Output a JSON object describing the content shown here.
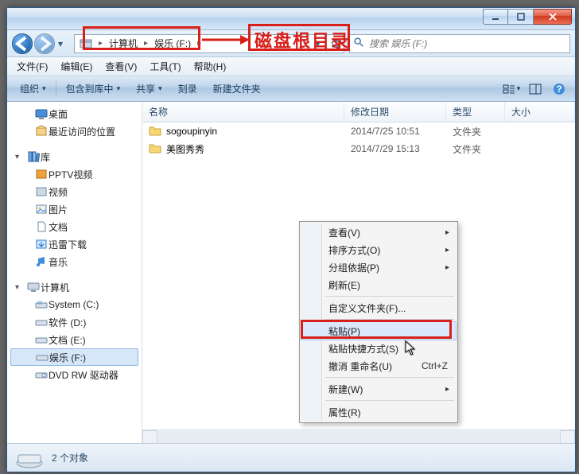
{
  "titlebar": {
    "min": "–",
    "max": "▢",
    "close": "×"
  },
  "nav": {
    "crumbs": [
      "计算机",
      "娱乐 (F:)"
    ],
    "search_placeholder": "搜索 娱乐 (F:)"
  },
  "menubar": [
    "文件(F)",
    "编辑(E)",
    "查看(V)",
    "工具(T)",
    "帮助(H)"
  ],
  "cmdbar": {
    "organize": "组织",
    "include": "包含到库中",
    "share": "共享",
    "burn": "刻录",
    "newfolder": "新建文件夹"
  },
  "tree": {
    "desktop": "桌面",
    "recent": "最近访问的位置",
    "libraries": "库",
    "lib_items": [
      "PPTV视频",
      "视频",
      "图片",
      "文档",
      "迅雷下载",
      "音乐"
    ],
    "computer": "计算机",
    "drives": [
      "System (C:)",
      "软件 (D:)",
      "文档 (E:)",
      "娱乐 (F:)",
      "DVD RW 驱动器"
    ]
  },
  "columns": {
    "name": "名称",
    "date": "修改日期",
    "type": "类型",
    "size": "大小"
  },
  "rows": [
    {
      "name": "sogoupinyin",
      "date": "2014/7/25 10:51",
      "type": "文件夹"
    },
    {
      "name": "美图秀秀",
      "date": "2014/7/29 15:13",
      "type": "文件夹"
    }
  ],
  "status": {
    "count": "2 个对象"
  },
  "context_menu": {
    "view": "查看(V)",
    "sort": "排序方式(O)",
    "group": "分组依据(P)",
    "refresh": "刷新(E)",
    "customize": "自定义文件夹(F)...",
    "paste": "粘贴(P)",
    "paste_shortcut": "粘贴快捷方式(S)",
    "undo": "撤消 重命名(U)",
    "undo_key": "Ctrl+Z",
    "new": "新建(W)",
    "props": "属性(R)"
  },
  "annotation": {
    "label": "磁盘根目录"
  }
}
